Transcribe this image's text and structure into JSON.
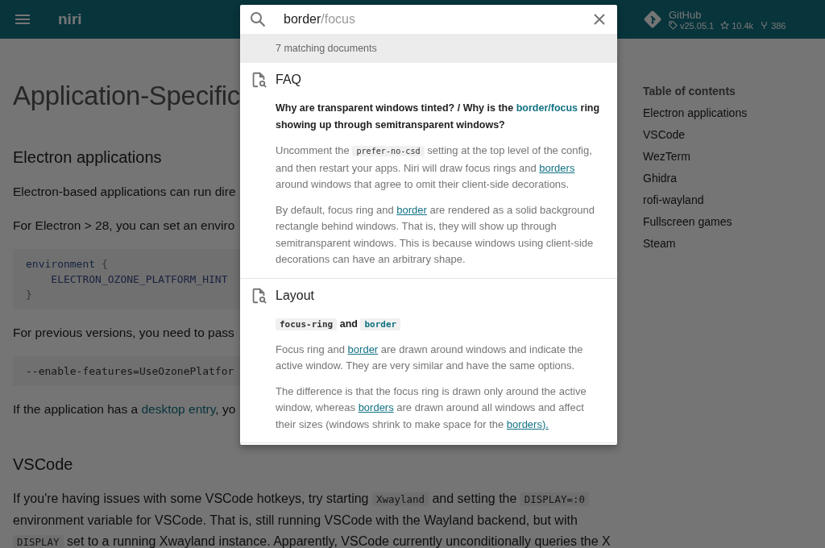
{
  "header": {
    "site_title": "niri",
    "search": {
      "value": "border",
      "suggestion": "/focus"
    },
    "repo": {
      "name": "GitHub",
      "version": "v25.05.1",
      "stars": "10.4k",
      "forks": "386"
    }
  },
  "page": {
    "title": "Application-Specific",
    "blocks": [
      {
        "kind": "h2",
        "text": "Electron applications"
      },
      {
        "kind": "p",
        "parts": [
          {
            "kind": "text",
            "text": "Electron-based applications can run dire"
          }
        ]
      },
      {
        "kind": "p",
        "parts": [
          {
            "kind": "text",
            "text": "For Electron > 28, you can set an enviro"
          }
        ]
      },
      {
        "kind": "code",
        "lines": [
          [
            {
              "kind": "keyword",
              "text": "environment"
            },
            {
              "kind": "punct",
              "text": " {"
            }
          ],
          [
            {
              "kind": "name",
              "text": "    ELECTRON_OZONE_PLATFORM_HINT"
            }
          ],
          [
            {
              "kind": "punct",
              "text": "}"
            }
          ]
        ]
      },
      {
        "kind": "p",
        "parts": [
          {
            "kind": "text",
            "text": "For previous versions, you need to pass"
          }
        ]
      },
      {
        "kind": "code",
        "lines": [
          [
            {
              "kind": "plain",
              "text": "--enable-features=UseOzonePlatfor"
            }
          ]
        ]
      },
      {
        "kind": "p",
        "parts": [
          {
            "kind": "text",
            "text": "If the application has a "
          },
          {
            "kind": "link",
            "text": "desktop entry"
          },
          {
            "kind": "text",
            "text": ", yo"
          }
        ]
      },
      {
        "kind": "h2",
        "text": "VSCode"
      },
      {
        "kind": "p",
        "parts": [
          {
            "kind": "text",
            "text": "If you're having issues with some VSCode hotkeys, try starting "
          },
          {
            "kind": "code",
            "text": "Xwayland"
          },
          {
            "kind": "text",
            "text": " and setting the "
          },
          {
            "kind": "code",
            "text": "DISPLAY=:0"
          },
          {
            "kind": "text",
            "text": " environment variable for VSCode. That is, still running VSCode with the Wayland backend, but with "
          },
          {
            "kind": "code",
            "text": "DISPLAY"
          },
          {
            "kind": "text",
            "text": " set to a running Xwayland instance. Apparently, VSCode currently unconditionally queries the X"
          }
        ]
      }
    ]
  },
  "toc": {
    "title": "Table of contents",
    "items": [
      "Electron applications",
      "VSCode",
      "WezTerm",
      "Ghidra",
      "rofi-wayland",
      "Fullscreen games",
      "Steam"
    ]
  },
  "search_results": {
    "count": "7 matching documents",
    "documents": [
      {
        "title": "FAQ",
        "blocks": [
          {
            "kind": "heading",
            "parts": [
              {
                "kind": "text",
                "text": "Why are transparent windows tinted? / Why is the "
              },
              {
                "kind": "mark",
                "text": "border/focus"
              },
              {
                "kind": "text",
                "text": " ring showing up through semitransparent windows?"
              }
            ]
          },
          {
            "kind": "p",
            "parts": [
              {
                "kind": "text",
                "text": "Uncomment the "
              },
              {
                "kind": "code",
                "text": "prefer-no-csd"
              },
              {
                "kind": "text",
                "text": " setting at the top level of the config, and then restart your apps. Niri will draw focus rings and "
              },
              {
                "kind": "link",
                "text": "borders"
              },
              {
                "kind": "text",
                "text": " around windows that agree to omit their client-side decorations."
              }
            ]
          },
          {
            "kind": "p",
            "parts": [
              {
                "kind": "text",
                "text": "By default, focus ring and "
              },
              {
                "kind": "link",
                "text": "border"
              },
              {
                "kind": "text",
                "text": " are rendered as a solid background rectangle behind windows. That is, they will show up through semitransparent windows. This is because windows using client-side decorations can have an arbitrary shape."
              }
            ]
          }
        ]
      },
      {
        "title": "Layout",
        "blocks": [
          {
            "kind": "heading",
            "parts": [
              {
                "kind": "code",
                "text": "focus-ring"
              },
              {
                "kind": "text",
                "text": " and "
              },
              {
                "kind": "codemark",
                "text": "border"
              }
            ]
          },
          {
            "kind": "p",
            "parts": [
              {
                "kind": "text",
                "text": "Focus ring and "
              },
              {
                "kind": "link",
                "text": "border"
              },
              {
                "kind": "text",
                "text": " are drawn around windows and indicate the active window. They are very similar and have the same options."
              }
            ]
          },
          {
            "kind": "p",
            "parts": [
              {
                "kind": "text",
                "text": "The difference is that the focus ring is drawn only around the active window, whereas "
              },
              {
                "kind": "link",
                "text": "borders"
              },
              {
                "kind": "text",
                "text": " are drawn around all windows and affect their sizes (windows shrink to make space for the "
              },
              {
                "kind": "link",
                "text": "borders)."
              }
            ]
          }
        ]
      }
    ]
  }
}
